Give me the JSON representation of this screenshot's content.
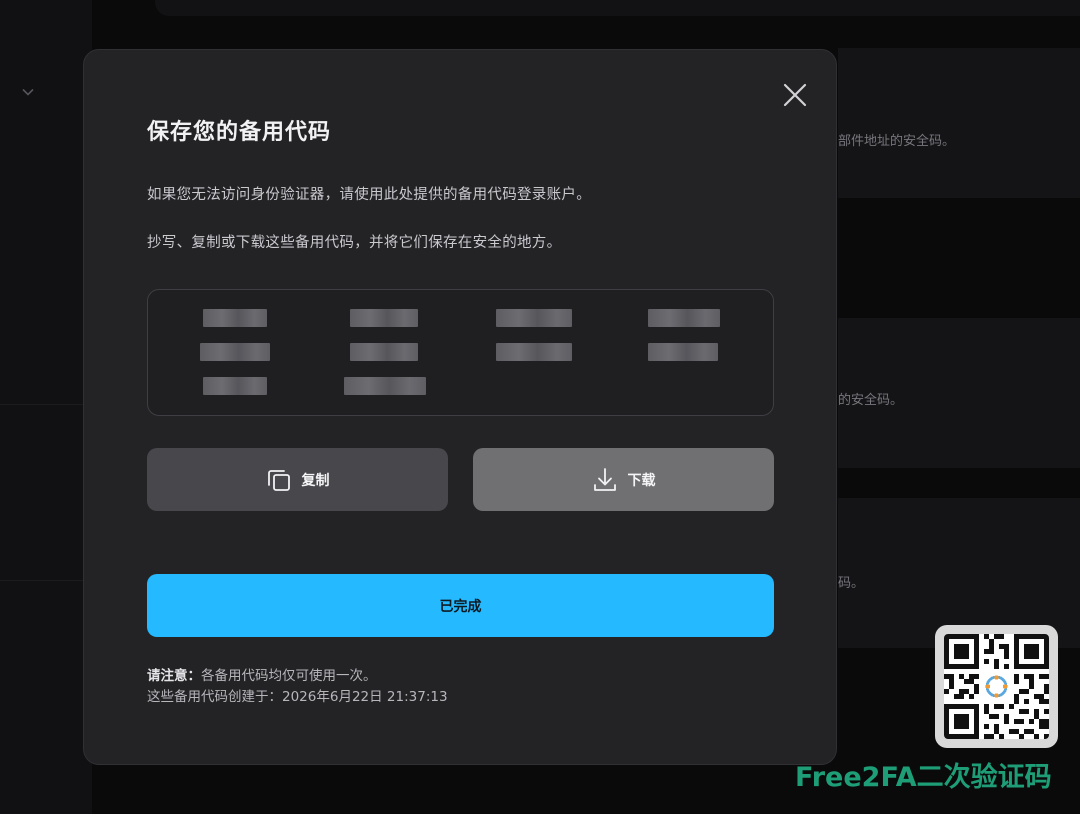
{
  "background": {
    "hint1": "部件地址的安全码。",
    "hint2": "的安全码。",
    "hint3": "码。"
  },
  "modal": {
    "title": "保存您的备用代码",
    "description1": "如果您无法访问身份验证器，请使用此处提供的备用代码登录账户。",
    "description2": "抄写、复制或下载这些备用代码，并将它们保存在安全的地方。",
    "copy_label": "复制",
    "download_label": "下载",
    "done_label": "已完成",
    "note_label": "请注意：",
    "note_text": "各备用代码均仅可使用一次。",
    "created_text": "这些备用代码创建于：2026年6月22日 21:37:13"
  },
  "watermark": {
    "text": "Free2FA二次验证码"
  },
  "colors": {
    "accent": "#25b9ff",
    "watermark": "#1e9e77"
  }
}
